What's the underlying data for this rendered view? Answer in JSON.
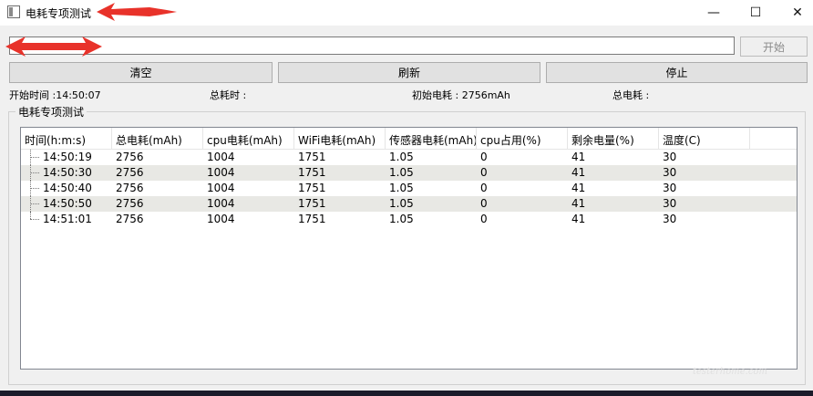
{
  "window": {
    "title": "电耗专项测试",
    "minimize_glyph": "—",
    "maximize_glyph": "☐",
    "close_glyph": "✕"
  },
  "toolbar": {
    "path_value": "",
    "start_label": "开始",
    "clear_label": "清空",
    "refresh_label": "刷新",
    "stop_label": "停止"
  },
  "info": {
    "start_time": "开始时间 :14:50:07",
    "total_time": "总耗时 :",
    "initial_power": "初始电耗 : 2756mAh",
    "total_power": "总电耗 :"
  },
  "group": {
    "title": "电耗专项测试"
  },
  "table": {
    "headers": [
      "时间(h:m:s)",
      "总电耗(mAh)",
      "cpu电耗(mAh)",
      "WiFi电耗(mAh)",
      "传感器电耗(mAh)",
      "cpu占用(%)",
      "剩余电量(%)",
      "温度(C)"
    ],
    "rows": [
      [
        "14:50:19",
        "2756",
        "1004",
        "1751",
        "1.05",
        "0",
        "41",
        "30"
      ],
      [
        "14:50:30",
        "2756",
        "1004",
        "1751",
        "1.05",
        "0",
        "41",
        "30"
      ],
      [
        "14:50:40",
        "2756",
        "1004",
        "1751",
        "1.05",
        "0",
        "41",
        "30"
      ],
      [
        "14:50:50",
        "2756",
        "1004",
        "1751",
        "1.05",
        "0",
        "41",
        "30"
      ],
      [
        "14:51:01",
        "2756",
        "1004",
        "1751",
        "1.05",
        "0",
        "41",
        "30"
      ]
    ]
  },
  "icons": {
    "app": "app-window-icon",
    "minimize": "minimize-icon",
    "maximize": "maximize-icon",
    "close": "close-icon"
  },
  "colors": {
    "annotation_arrow": "#e8322a",
    "alt_row": "#e8e8e4",
    "button_face": "#e1e1e1"
  },
  "watermark": "testerhome.com"
}
